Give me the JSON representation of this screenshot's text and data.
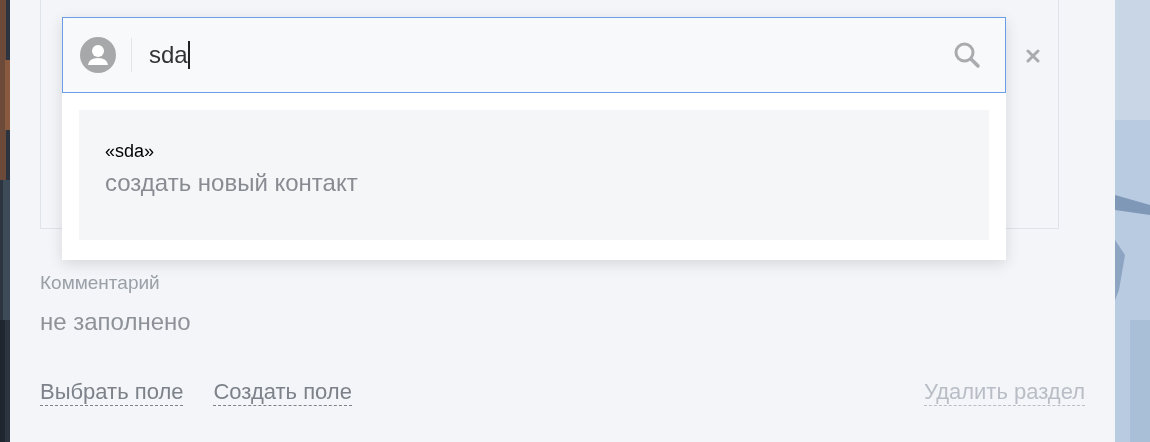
{
  "contact_search": {
    "value": "sda"
  },
  "suggestion": {
    "query": "«sda»",
    "action": "создать новый контакт"
  },
  "comment": {
    "label": "Комментарий",
    "value": "не заполнено"
  },
  "links": [
    {
      "label": "Выбрать поле",
      "kind": "action"
    },
    {
      "label": "Создать поле",
      "kind": "action"
    },
    {
      "label": "Удалить раздел",
      "kind": "delete"
    }
  ]
}
